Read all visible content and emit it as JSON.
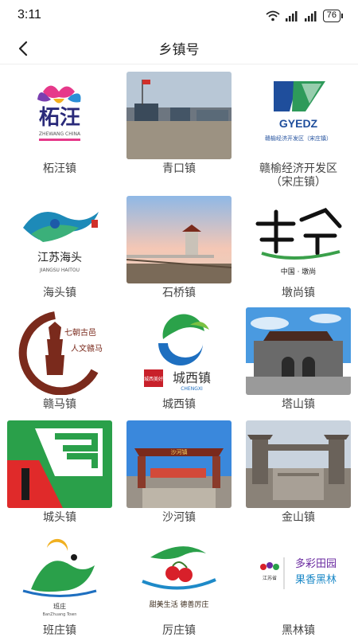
{
  "status_bar": {
    "time": "3:11",
    "battery": "76"
  },
  "header": {
    "title": "乡镇号"
  },
  "logo_text": {
    "zhewang": "柘汪",
    "zhewang_en": "ZHEWANG CHINA",
    "gyedz": "GYEDZ",
    "gyedz_sub": "赣榆经济开发区（宋庄镇）",
    "haitou": "江苏海头",
    "haitou_en": "JIANGSU HAITOU",
    "dunshang": "中国 · 墩尚",
    "ganma": "七朝古邑",
    "ganma2": "人文赣马",
    "chengxi": "城西镇",
    "chengxi_en": "CHENGXI",
    "chengxi_seal": "城西美好",
    "shahe_gate": "沙河镇",
    "ban": "班庄",
    "ban_en": "BanZhuang Town",
    "houzhuang": "甜美生活 德善厉庄",
    "heilin1": "多彩田园",
    "heilin2": "果香黑林",
    "heilin3": "江苏省"
  },
  "towns": [
    {
      "label": "柘汪镇"
    },
    {
      "label": "青口镇"
    },
    {
      "label": "赣榆经济开发区\n（宋庄镇）"
    },
    {
      "label": "海头镇"
    },
    {
      "label": "石桥镇"
    },
    {
      "label": "墩尚镇"
    },
    {
      "label": "赣马镇"
    },
    {
      "label": "城西镇"
    },
    {
      "label": "塔山镇"
    },
    {
      "label": "城头镇"
    },
    {
      "label": "沙河镇"
    },
    {
      "label": "金山镇"
    },
    {
      "label": "班庄镇"
    },
    {
      "label": "厉庄镇"
    },
    {
      "label": "黑林镇"
    }
  ],
  "colors": {
    "text": "#444444",
    "title": "#222222",
    "divider": "#eeeeee"
  },
  "icons": {
    "back": "chevron-left-icon",
    "wifi": "wifi-icon",
    "signal": "signal-icon"
  }
}
